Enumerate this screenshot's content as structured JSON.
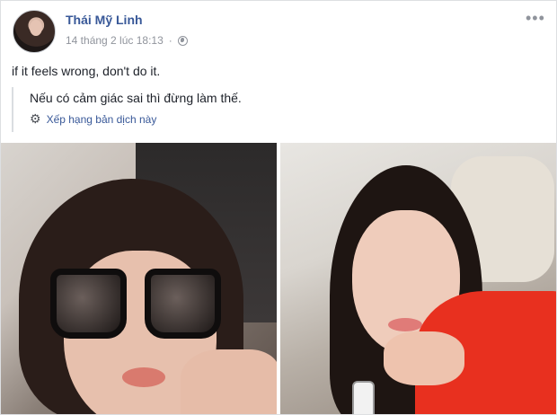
{
  "post": {
    "author": "Thái Mỹ Linh",
    "date": "14 tháng 2 lúc 18:13",
    "separator": "·",
    "privacy_icon": "globe-icon",
    "more_icon": "more-options-icon",
    "text": "if it feels wrong, don't do it.",
    "translation": {
      "text": "Nếu có cảm giác sai thì đừng làm thế.",
      "rate_label": "Xếp hạng bản dịch này",
      "rate_icon": "gear-icon"
    },
    "photos": [
      {
        "alt": "photo-1"
      },
      {
        "alt": "photo-2"
      }
    ]
  },
  "colors": {
    "author": "#385898",
    "meta": "#90949c",
    "text": "#1d2129",
    "link": "#385898"
  }
}
